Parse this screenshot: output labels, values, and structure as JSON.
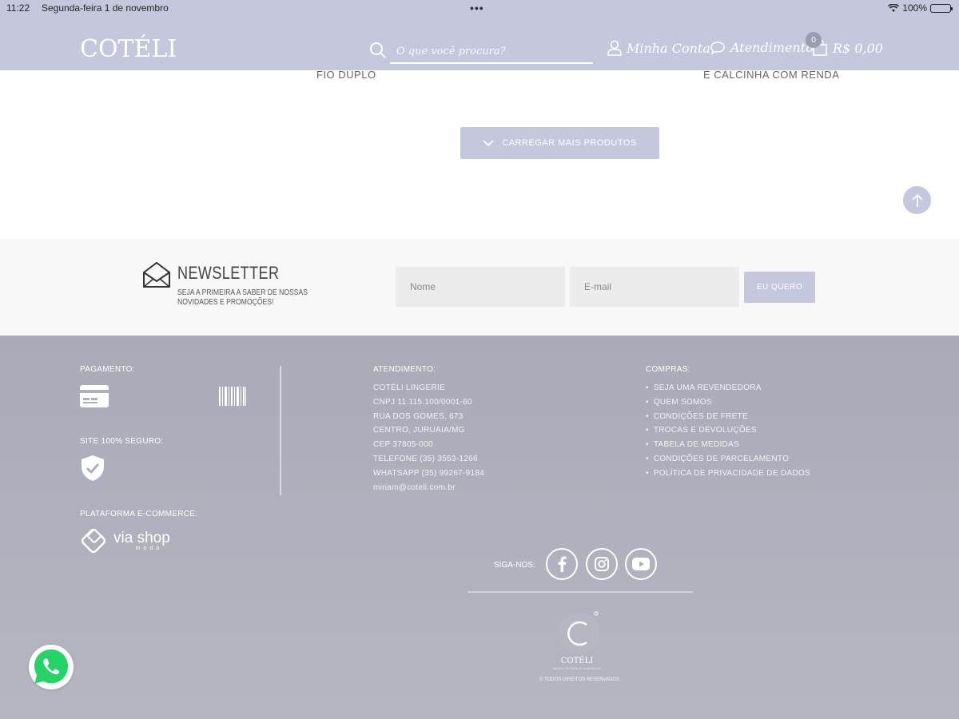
{
  "status_bar": {
    "time": "11:22",
    "date": "Segunda-feira 1 de novembro",
    "dots": "•••",
    "battery": "100%"
  },
  "header": {
    "logo": "COTÉLI",
    "search_placeholder": "O que você procura?",
    "account_label": "Minha Conta",
    "support_label": "Atendimento",
    "cart_count": "0",
    "cart_total": "R$ 0,00"
  },
  "products": {
    "name_1": "FIO DUPLO",
    "name_2": "E CALCINHA COM RENDA"
  },
  "load_more_label": "CARREGAR MAIS PRODUTOS",
  "newsletter": {
    "title": "NEWSLETTER",
    "subtitle": "SEJA A PRIMEIRA A SABER DE NOSSAS NOVIDADES E PROMOÇÕES!",
    "name_placeholder": "Nome",
    "email_placeholder": "E-mail",
    "submit_label": "EU QUERO"
  },
  "footer": {
    "payment_heading": "PAGAMENTO:",
    "secure_heading": "SITE 100% SEGURO:",
    "platform_heading": "PLATAFORMA E-COMMERCE:",
    "platform_name": "via shop",
    "platform_sub": "moda",
    "contact_heading": "ATENDIMENTO:",
    "contact_lines": [
      "COTÉLI LINGERIE",
      "CNPJ 11.115.100/0001-60",
      "RUA DOS GOMES, 673",
      "CENTRO, JURUAIA/MG",
      "CEP 37805-000",
      "TELEFONE (35) 3553-1266",
      "WHATSAPP (35) 99267-9184",
      "miriam@coteli.com.br"
    ],
    "shop_heading": "COMPRAS:",
    "shop_links": [
      "SEJA UMA REVENDEDORA",
      "QUEM SOMOS",
      "CONDIÇÕES DE FRETE",
      "TROCAS E DEVOLUÇÕES",
      "TABELA DE MEDIDAS",
      "CONDIÇÕES DE PARCELAMENTO",
      "POLÍTICA DE PRIVACIDADE DE DADOS"
    ],
    "follow_label": "SIGA-NOS:",
    "brand": "COTÉLI",
    "brand_tag": "MODA ÍNTIMA & LINGERIE",
    "copyright": "© TODOS DIREITOS RESERVADOS"
  },
  "colors": {
    "header_bg": "#c5c8dc",
    "footer_bg": "#aeb0bd",
    "newsletter_bg": "#f8f8f8",
    "whatsapp_green": "#25d366"
  },
  "icons": {
    "search": "search-icon",
    "account": "user-icon",
    "support": "chat-bubble-icon",
    "cart": "shopping-bag-icon",
    "load_more": "chevron-down-icon",
    "scroll_top": "arrow-up-icon",
    "newsletter": "envelope-icon",
    "payment_card": "credit-card-icon",
    "payment_boleto": "barcode-icon",
    "secure": "shield-check-icon",
    "social": [
      "facebook-icon",
      "instagram-icon",
      "youtube-icon"
    ],
    "whatsapp": "whatsapp-icon"
  }
}
